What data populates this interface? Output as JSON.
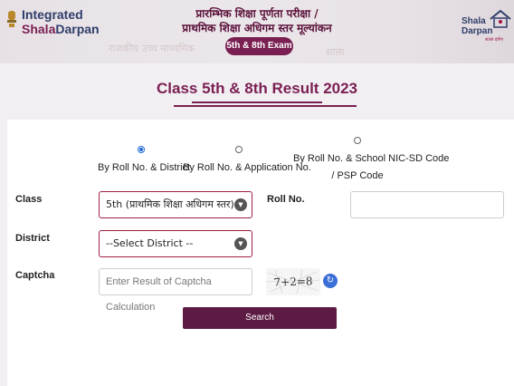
{
  "header": {
    "logo_line1": "Integrated",
    "logo_line2_a": "Shala",
    "logo_line2_b": "Darpan",
    "title_line1": "प्रारम्भिक शिक्षा पूर्णता परीक्षा /",
    "title_line2": "प्राथमिक शिक्षा अधिगम स्तर मूल्यांकन",
    "exam_badge": "5th & 8th Exam",
    "right_logo_line1": "Shala",
    "right_logo_line2": "Darpan",
    "right_logo_tag": "शाला दर्पण"
  },
  "page_title": "Class 5th & 8th Result 2023",
  "search_options": [
    {
      "label": "By Roll No. & District",
      "selected": true
    },
    {
      "label": "By Roll No. & Application No.",
      "selected": false
    },
    {
      "label_line1": "By Roll No. & School NIC-SD Code",
      "label_line2": "/ PSP Code",
      "selected": false
    }
  ],
  "form": {
    "class_label": "Class",
    "class_value": "5th (प्राथमिक शिक्षा अधिगम स्तर)",
    "roll_label": "Roll No.",
    "roll_value": "",
    "district_label": "District",
    "district_value": "--Select District --",
    "captcha_label": "Captcha",
    "captcha_placeholder": "Enter Result of Captcha Calculation",
    "captcha_text": "7+2=8",
    "search_button": "Search"
  },
  "colors": {
    "brand": "#7a1f52",
    "button": "#5d1a42",
    "radio_selected": "#1a66d6"
  }
}
